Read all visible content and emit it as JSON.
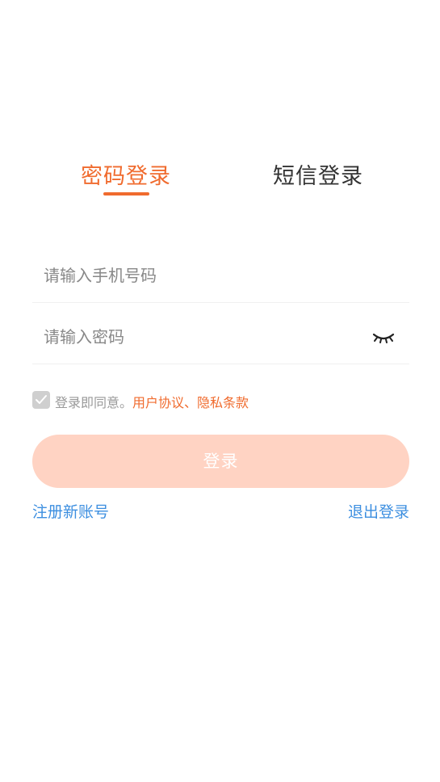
{
  "tabs": {
    "password_login": "密码登录",
    "sms_login": "短信登录",
    "active": "password_login"
  },
  "form": {
    "phone_placeholder": "请输入手机号码",
    "phone_value": "",
    "password_placeholder": "请输入密码",
    "password_value": "",
    "password_toggle_icon": "eye-closed-icon"
  },
  "agreement": {
    "checked": true,
    "prefix": "登录即同意。",
    "links": "用户协议、隐私条款"
  },
  "login_button_label": "登录",
  "links": {
    "register": "注册新账号",
    "logout": "退出登录"
  },
  "colors": {
    "accent": "#f06b2e",
    "button_disabled": "#ffd3c3",
    "link": "#3d8fe0",
    "checkbox": "#cfcfcf"
  }
}
